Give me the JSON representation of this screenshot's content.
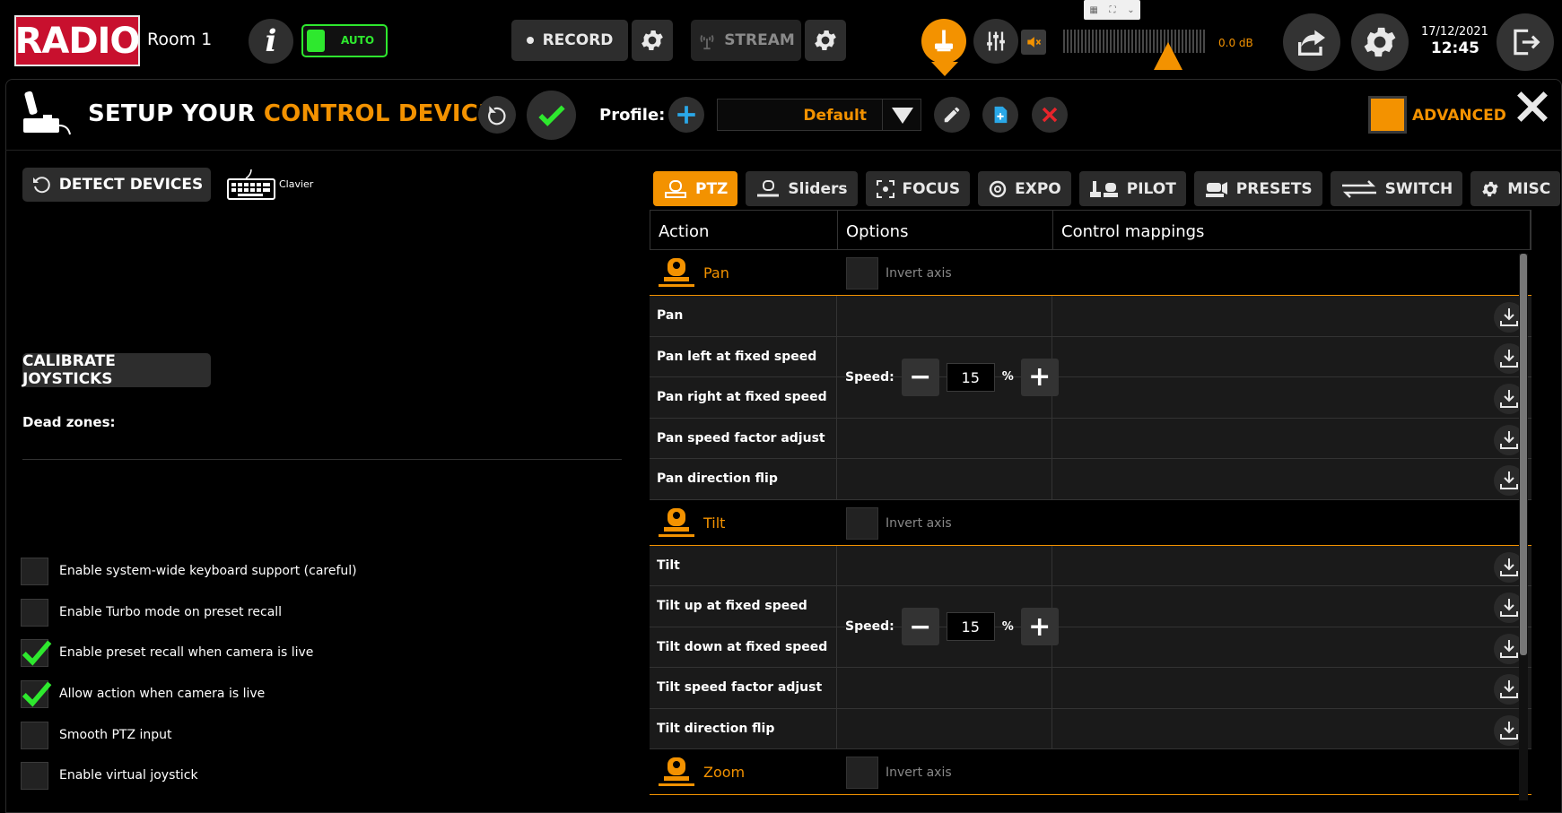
{
  "topbar": {
    "logo": "RADIO",
    "room": "Room 1",
    "auto_label": "AUTO",
    "record_label": "RECORD",
    "stream_label": "STREAM",
    "db_readout": "0.0 dB",
    "date": "17/12/2021",
    "time": "12:45"
  },
  "header": {
    "title_prefix": "SETUP YOUR ",
    "title_highlight": "CONTROL DEVICES",
    "profile_label": "Profile:",
    "profile_value": "Default",
    "advanced_label": "ADVANCED"
  },
  "left": {
    "detect_label": "DETECT DEVICES",
    "keyboard_label": "Clavier",
    "calibrate_label": "CALIBRATE JOYSTICKS",
    "deadzones_label": "Dead zones:",
    "options": [
      {
        "label": "Enable system-wide keyboard support (careful)",
        "checked": false
      },
      {
        "label": "Enable Turbo mode on preset recall",
        "checked": false
      },
      {
        "label": "Enable preset recall when camera is live",
        "checked": true
      },
      {
        "label": "Allow action when camera is live",
        "checked": true
      },
      {
        "label": "Smooth PTZ input",
        "checked": false
      },
      {
        "label": "Enable virtual joystick",
        "checked": false
      }
    ]
  },
  "tabs": [
    {
      "label": "PTZ",
      "active": true
    },
    {
      "label": "Sliders",
      "active": false
    },
    {
      "label": "FOCUS",
      "active": false
    },
    {
      "label": "EXPO",
      "active": false
    },
    {
      "label": "PILOT",
      "active": false
    },
    {
      "label": "PRESETS",
      "active": false
    },
    {
      "label": "SWITCH",
      "active": false
    },
    {
      "label": "MISC",
      "active": false
    }
  ],
  "grid": {
    "headers": [
      "Action",
      "Options",
      "Control mappings"
    ],
    "invert_label": "Invert axis",
    "speed_label": "Speed:",
    "percent": "%",
    "sections": [
      {
        "name": "Pan",
        "speed": "15",
        "rows": [
          "Pan",
          "Pan left at fixed speed",
          "Pan right at fixed speed",
          "Pan speed factor adjust",
          "Pan direction flip"
        ]
      },
      {
        "name": "Tilt",
        "speed": "15",
        "rows": [
          "Tilt",
          "Tilt up at fixed speed",
          "Tilt down at fixed speed",
          "Tilt speed factor adjust",
          "Tilt direction flip"
        ]
      },
      {
        "name": "Zoom",
        "speed": "",
        "rows": []
      }
    ]
  },
  "colors": {
    "accent": "#f39200",
    "brand_red": "#c8102e",
    "ok_green": "#2ee82e"
  }
}
